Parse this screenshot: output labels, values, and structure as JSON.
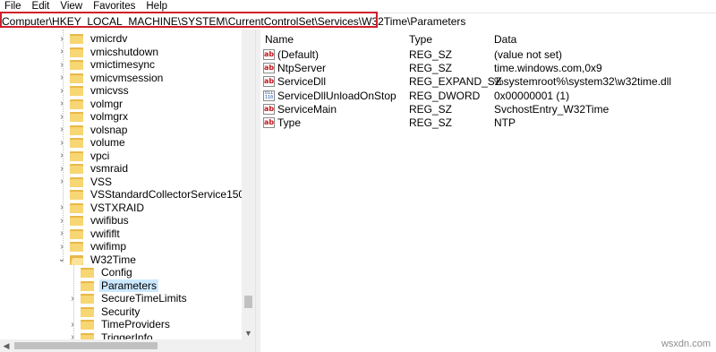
{
  "menu": [
    "File",
    "Edit",
    "View",
    "Favorites",
    "Help"
  ],
  "address": "Computer\\HKEY_LOCAL_MACHINE\\SYSTEM\\CurrentControlSet\\Services\\W32Time\\Parameters",
  "tree": {
    "items": [
      {
        "label": "vmicrdv",
        "expander": "collapsed",
        "depth": 0
      },
      {
        "label": "vmicshutdown",
        "expander": "collapsed",
        "depth": 0
      },
      {
        "label": "vmictimesync",
        "expander": "collapsed",
        "depth": 0
      },
      {
        "label": "vmicvmsession",
        "expander": "collapsed",
        "depth": 0
      },
      {
        "label": "vmicvss",
        "expander": "collapsed",
        "depth": 0
      },
      {
        "label": "volmgr",
        "expander": "collapsed",
        "depth": 0
      },
      {
        "label": "volmgrx",
        "expander": "collapsed",
        "depth": 0
      },
      {
        "label": "volsnap",
        "expander": "collapsed",
        "depth": 0
      },
      {
        "label": "volume",
        "expander": "collapsed",
        "depth": 0
      },
      {
        "label": "vpci",
        "expander": "collapsed",
        "depth": 0
      },
      {
        "label": "vsmraid",
        "expander": "collapsed",
        "depth": 0
      },
      {
        "label": "VSS",
        "expander": "collapsed",
        "depth": 0
      },
      {
        "label": "VSStandardCollectorService150",
        "expander": "none",
        "depth": 0
      },
      {
        "label": "VSTXRAID",
        "expander": "collapsed",
        "depth": 0
      },
      {
        "label": "vwifibus",
        "expander": "collapsed",
        "depth": 0
      },
      {
        "label": "vwififlt",
        "expander": "collapsed",
        "depth": 0
      },
      {
        "label": "vwifimp",
        "expander": "collapsed",
        "depth": 0
      },
      {
        "label": "W32Time",
        "expander": "expanded",
        "depth": 0
      },
      {
        "label": "Config",
        "expander": "none",
        "depth": 1
      },
      {
        "label": "Parameters",
        "expander": "none",
        "depth": 1,
        "selected": true
      },
      {
        "label": "SecureTimeLimits",
        "expander": "collapsed",
        "depth": 1
      },
      {
        "label": "Security",
        "expander": "none",
        "depth": 1
      },
      {
        "label": "TimeProviders",
        "expander": "collapsed",
        "depth": 1
      },
      {
        "label": "TriggerInfo",
        "expander": "collapsed",
        "depth": 1
      }
    ]
  },
  "values_table": {
    "columns": [
      "Name",
      "Type",
      "Data"
    ],
    "rows": [
      {
        "icon": "string-value-icon",
        "name": "(Default)",
        "type": "REG_SZ",
        "data": "(value not set)"
      },
      {
        "icon": "string-value-icon",
        "name": "NtpServer",
        "type": "REG_SZ",
        "data": "time.windows.com,0x9"
      },
      {
        "icon": "string-value-icon",
        "name": "ServiceDll",
        "type": "REG_EXPAND_SZ",
        "data": "%systemroot%\\system32\\w32time.dll"
      },
      {
        "icon": "dword-value-icon",
        "name": "ServiceDllUnloadOnStop",
        "type": "REG_DWORD",
        "data": "0x00000001 (1)"
      },
      {
        "icon": "string-value-icon",
        "name": "ServiceMain",
        "type": "REG_SZ",
        "data": "SvchostEntry_W32Time"
      },
      {
        "icon": "string-value-icon",
        "name": "Type",
        "type": "REG_SZ",
        "data": "NTP"
      }
    ]
  },
  "watermark": "wsxdn.com",
  "colors": {
    "highlight_border": "#d0202a",
    "selection": "#cce8ff",
    "folder": "#f7d674"
  }
}
